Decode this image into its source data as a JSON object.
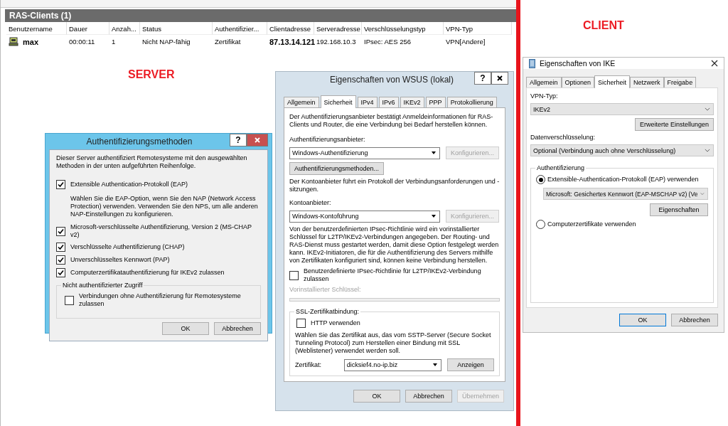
{
  "ras_clients": {
    "title": "RAS-Clients (1)",
    "columns": [
      {
        "label": "Benutzername",
        "emphasis": true
      },
      {
        "label": "Dauer",
        "emphasis": false
      },
      {
        "label": "Anzah...",
        "emphasis": false
      },
      {
        "label": "Status",
        "emphasis": false
      },
      {
        "label": "Authentifizier...",
        "emphasis": false
      },
      {
        "label": "Clientadresse",
        "emphasis": true
      },
      {
        "label": "Serveradresse",
        "emphasis": false
      },
      {
        "label": "Verschlüsselungstyp",
        "emphasis": false
      },
      {
        "label": "VPN-Typ",
        "emphasis": false
      }
    ],
    "rows": [
      {
        "cells": [
          "max",
          "00:00:11",
          "1",
          "Nicht NAP-fähig",
          "Zertifikat",
          "87.13.14.121",
          "192.168.10.3",
          "IPsec: AES 256",
          "VPN[Andere]"
        ]
      }
    ]
  },
  "server_label": "SERVER",
  "client_label": "CLIENT",
  "auth_dialog": {
    "title": "Authentifizierungsmethoden",
    "help_button": "?",
    "intro": "Dieser Server authentifiziert Remotesysteme mit den ausgewählten Methoden in der unten aufgeführten Reihenfolge.",
    "methods": [
      {
        "label": "Extensible Authentication-Protokoll (EAP)",
        "checked": true,
        "note": "Wählen Sie die EAP-Option, wenn Sie den NAP (Network Access Protection) verwenden. Verwenden Sie den NPS, um alle anderen NAP-Einstellungen zu konfigurieren."
      },
      {
        "label": "Microsoft-verschlüsselte Authentifizierung, Version 2 (MS-CHAP v2)",
        "checked": true
      },
      {
        "label": "Verschlüsselte Authentifizierung (CHAP)",
        "checked": true
      },
      {
        "label": "Unverschlüsseltes Kennwort (PAP)",
        "checked": true
      },
      {
        "label": "Computerzertifikatauthentifizierung für IKEv2 zulassen",
        "checked": true
      }
    ],
    "group": {
      "title": "Nicht authentifizierter Zugriff",
      "options": [
        {
          "label": "Verbindungen ohne Authentifizierung für Remotesysteme zulassen",
          "checked": false
        }
      ]
    },
    "buttons": [
      "OK",
      "Abbrechen"
    ]
  },
  "wsus_dialog": {
    "title": "Eigenschaften von WSUS (lokal)",
    "help_button": "?",
    "tabs": [
      {
        "label": "Allgemein",
        "selected": false
      },
      {
        "label": "Sicherheit",
        "selected": true
      },
      {
        "label": "IPv4",
        "selected": false
      },
      {
        "label": "IPv6",
        "selected": false
      },
      {
        "label": "IKEv2",
        "selected": false
      },
      {
        "label": "PPP",
        "selected": false
      },
      {
        "label": "Protokollierung",
        "selected": false
      }
    ],
    "auth_intro": "Der Authentifizierungsanbieter bestätigt Anmeldeinformationen für RAS-Clients und Router, die eine Verbindung bei Bedarf herstellen können.",
    "auth_provider": {
      "label": "Authentifizierungsanbieter:",
      "value": "Windows-Authentifizierung",
      "configure": {
        "label": "Konfigurieren...",
        "disabled": true
      }
    },
    "auth_methods_button": "Authentifizierungsmethoden...",
    "account_intro": "Der Kontoanbieter führt ein Protokoll der Verbindungsanforderungen und -sitzungen.",
    "account_provider": {
      "label": "Kontoanbieter:",
      "value": "Windows-Kontoführung",
      "configure": {
        "label": "Konfigurieren...",
        "disabled": true
      }
    },
    "ipsec_note": "Von der benutzerdefinierten IPsec-Richtlinie wird ein vorinstallierter Schlüssel für L2TP/IKEv2-Verbindungen angegeben. Der Routing- und RAS-Dienst muss gestartet werden, damit diese Option festgelegt werden kann. IKEv2-Initiatoren, die für die Authentifizierung des Servers mithilfe von Zertifikaten konfiguriert sind, können keine Verbindung herstellen.",
    "ipsec_option": {
      "label": "Benutzerdefinierte IPsec-Richtlinie für L2TP/IKEv2-Verbindung zulassen",
      "checked": false
    },
    "preshared_key": {
      "label": "Vorinstallierter Schlüssel:",
      "disabled": true
    },
    "ssl": {
      "title": "SSL-Zertifikatbindung:",
      "http": {
        "label": "HTTP verwenden",
        "checked": false
      },
      "note": "Wählen Sie das Zertifikat aus, das vom SSTP-Server (Secure Socket Tunneling Protocol) zum Herstellen einer Bindung mit SSL (Weblistener) verwendet werden soll.",
      "certificate": {
        "label": "Zertifikat:",
        "value": "dicksief4.no-ip.biz"
      },
      "show_button": "Anzeigen"
    },
    "buttons": [
      {
        "label": "OK",
        "disabled": false
      },
      {
        "label": "Abbrechen",
        "disabled": false
      },
      {
        "label": "Übernehmen",
        "disabled": true
      }
    ]
  },
  "ike_dialog": {
    "title": "Eigenschaften von IKE",
    "tabs": [
      {
        "label": "Allgemein",
        "selected": false
      },
      {
        "label": "Optionen",
        "selected": false
      },
      {
        "label": "Sicherheit",
        "selected": true
      },
      {
        "label": "Netzwerk",
        "selected": false
      },
      {
        "label": "Freigabe",
        "selected": false
      }
    ],
    "vpn_type": {
      "label": "VPN-Typ:",
      "value": "IKEv2"
    },
    "advanced_button": "Erweiterte Einstellungen",
    "encryption": {
      "label": "Datenverschlüsselung:",
      "value": "Optional (Verbindung auch ohne Verschlüsselung)"
    },
    "auth_group": {
      "title": "Authentifizierung",
      "options": [
        {
          "label": "Extensible-Authentication-Protokoll (EAP) verwenden",
          "selected": true
        },
        {
          "label": "Computerzertifikate verwenden",
          "selected": false
        }
      ],
      "eap_method": "Microsoft: Gesichertes Kennwort (EAP-MSCHAP v2) (Ve",
      "properties_button": "Eigenschaften"
    },
    "buttons": [
      {
        "label": "OK",
        "selected": true
      },
      {
        "label": "Abbrechen",
        "selected": false
      }
    ]
  }
}
